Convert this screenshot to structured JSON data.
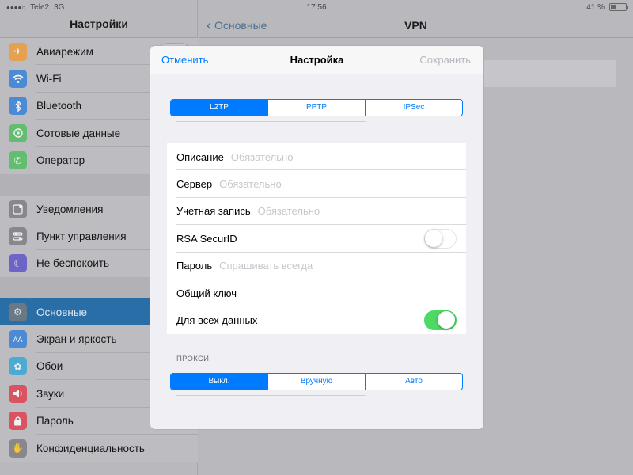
{
  "status": {
    "carrier": "Tele2",
    "network": "3G",
    "time": "17:56",
    "battery": "41 %",
    "battery_level": 0.41
  },
  "sidebar": {
    "title": "Настройки",
    "groups": [
      [
        {
          "label": "Авиарежим",
          "icon": "airplane-icon",
          "color": "#f19a37"
        },
        {
          "label": "Wi-Fi",
          "icon": "wifi-icon",
          "color": "#2f7ed9"
        },
        {
          "label": "Bluetooth",
          "icon": "bluetooth-icon",
          "color": "#2f7ed9"
        },
        {
          "label": "Сотовые данные",
          "icon": "cellular-icon",
          "color": "#4cbe5b"
        },
        {
          "label": "Оператор",
          "icon": "phone-icon",
          "color": "#4cbe5b"
        }
      ],
      [
        {
          "label": "Уведомления",
          "icon": "notifications-icon",
          "color": "#7c7c80"
        },
        {
          "label": "Пункт управления",
          "icon": "control-center-icon",
          "color": "#7c7c80"
        },
        {
          "label": "Не беспокоить",
          "icon": "moon-icon",
          "color": "#5a4fc9"
        }
      ],
      [
        {
          "label": "Основные",
          "icon": "gear-icon",
          "color": "#7c7c80",
          "selected": true
        },
        {
          "label": "Экран и яркость",
          "icon": "display-icon",
          "color": "#2f7ed9"
        },
        {
          "label": "Обои",
          "icon": "wallpaper-icon",
          "color": "#32a7d8"
        },
        {
          "label": "Звуки",
          "icon": "sound-icon",
          "color": "#e0394a"
        },
        {
          "label": "Пароль",
          "icon": "lock-icon",
          "color": "#e0394a"
        },
        {
          "label": "Конфиденциальность",
          "icon": "hand-icon",
          "color": "#7c7c80"
        }
      ]
    ]
  },
  "detail": {
    "back_label": "Основные",
    "title": "VPN"
  },
  "modal": {
    "cancel": "Отменить",
    "title": "Настройка",
    "save": "Сохранить",
    "vpn_types": [
      "L2TP",
      "PPTP",
      "IPSec"
    ],
    "vpn_type_selected": 0,
    "fields": [
      {
        "label": "Описание",
        "placeholder": "Обязательно"
      },
      {
        "label": "Сервер",
        "placeholder": "Обязательно"
      },
      {
        "label": "Учетная запись",
        "placeholder": "Обязательно"
      },
      {
        "label": "RSA SecurID",
        "toggle": false
      },
      {
        "label": "Пароль",
        "placeholder": "Спрашивать всегда"
      },
      {
        "label": "Общий ключ",
        "placeholder": ""
      },
      {
        "label": "Для всех данных",
        "toggle": true
      }
    ],
    "proxy_label": "ПРОКСИ",
    "proxy_options": [
      "Выкл.",
      "Вручную",
      "Авто"
    ],
    "proxy_selected": 0
  }
}
